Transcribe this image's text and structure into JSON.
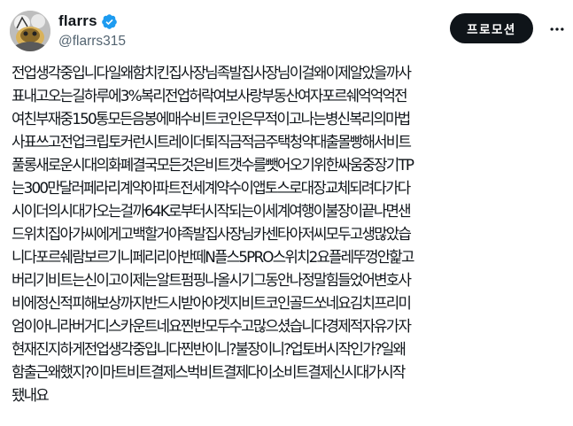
{
  "author": {
    "display_name": "flarrs",
    "handle": "@flarrs315",
    "verified_icon": "verified-badge-icon",
    "verified_color": "#1d9bf0"
  },
  "actions": {
    "promote_label": "프로모션",
    "more_icon": "more-horizontal-icon"
  },
  "tweet": {
    "text": "전업생각중입니다일왜함치킨집사장님족발집사장님이걸왜이제알았을까사\n표내고오는길하루에3%복리전업허락여보사랑부동산여자포르쉐억억억전\n여친부재중150통모든음봉에매수비트코인은무적이고나는병신복리의마법\n사표쓰고전업크립토커런시트레이더퇴직금적금주택청약대출몰빵해서비트\n풀롱새로운시대의화폐결국모든것은비트갯수를뺏어오기위한싸움중장기TP\n는300만달러페라리계약아파트전세계약수이앱토스로대장교체되려다가다\n시이더의시대가오는걸까64K로부터시작되는이세계여행이불장이끝나면샌\n드위치집아가씨에게고백할거야족발집사장님카센타아저씨모두고생많았습\n니다포르쉐람보르기니페리리아반떼N플스5PRO스위치2요플레뚜껑안핥고\n버리기비트는신이고이제는알트펌핑나올시기그동안나정말힘들었어변호사\n비에정신적피해보상까지반드시받아야겟지비트코인골드쏘네요김치프리미\n엄이아니라버거디스카운트네요찐반모두수고많으셨습니다경제적자유가자\n현재진지하게전업생각중입니다찐반이니?불장이니?업토버시작인가?일왜\n함출근왜했지?이마트비트결제스벅비트결제다이소비트결제신시대가시작\n됐내요"
  }
}
